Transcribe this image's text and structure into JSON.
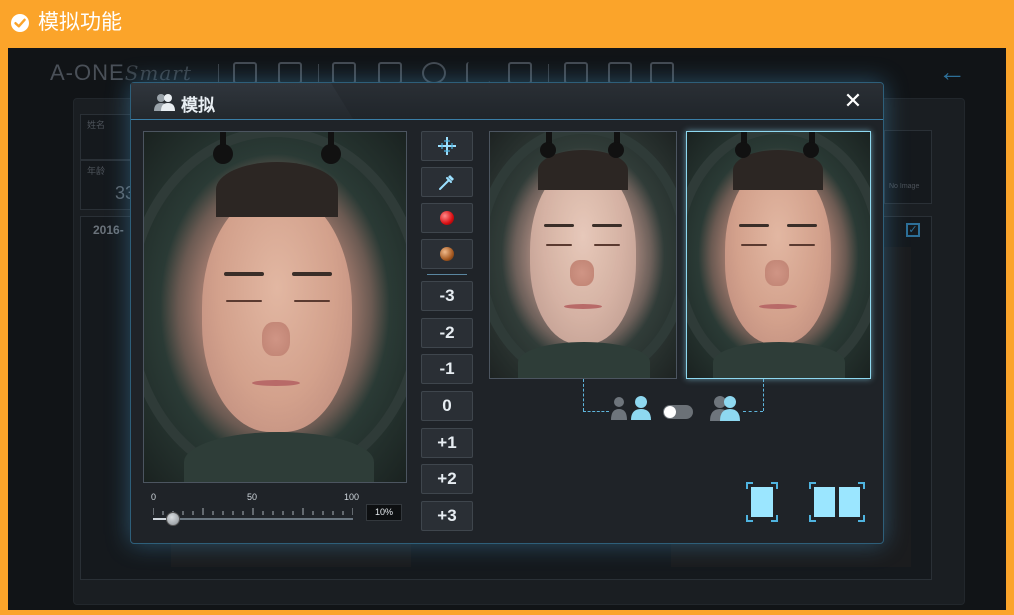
{
  "header": {
    "title": "模拟功能"
  },
  "background_app": {
    "brand_main": "A-ONE",
    "brand_script": "Smart",
    "fields": [
      {
        "label": "姓名",
        "value": ""
      },
      {
        "label": "年龄",
        "value": "33"
      }
    ],
    "date": "2016-",
    "right_box_label": "No Image"
  },
  "modal": {
    "title": "模拟",
    "close": "✕",
    "slider": {
      "ticks": [
        "0",
        "50",
        "100"
      ],
      "value_percent": 10,
      "display": "10%"
    },
    "tools": [
      {
        "name": "crosshair-tool",
        "icon": "crosshair-icon"
      },
      {
        "name": "eyedropper-tool",
        "icon": "eyedropper-icon"
      },
      {
        "name": "red-dot-tool",
        "icon": "red-sphere-icon"
      },
      {
        "name": "brown-dot-tool",
        "icon": "brown-sphere-icon"
      }
    ],
    "levels": [
      "-3",
      "-2",
      "-1",
      "0",
      "+1",
      "+2",
      "+3"
    ],
    "compare": {
      "toggle_on": false
    },
    "colors": {
      "accent": "#8ed8f0",
      "border_glow": "#3a7ea6",
      "panel": "#1f2328",
      "header_bar": "#FBA42A"
    }
  }
}
